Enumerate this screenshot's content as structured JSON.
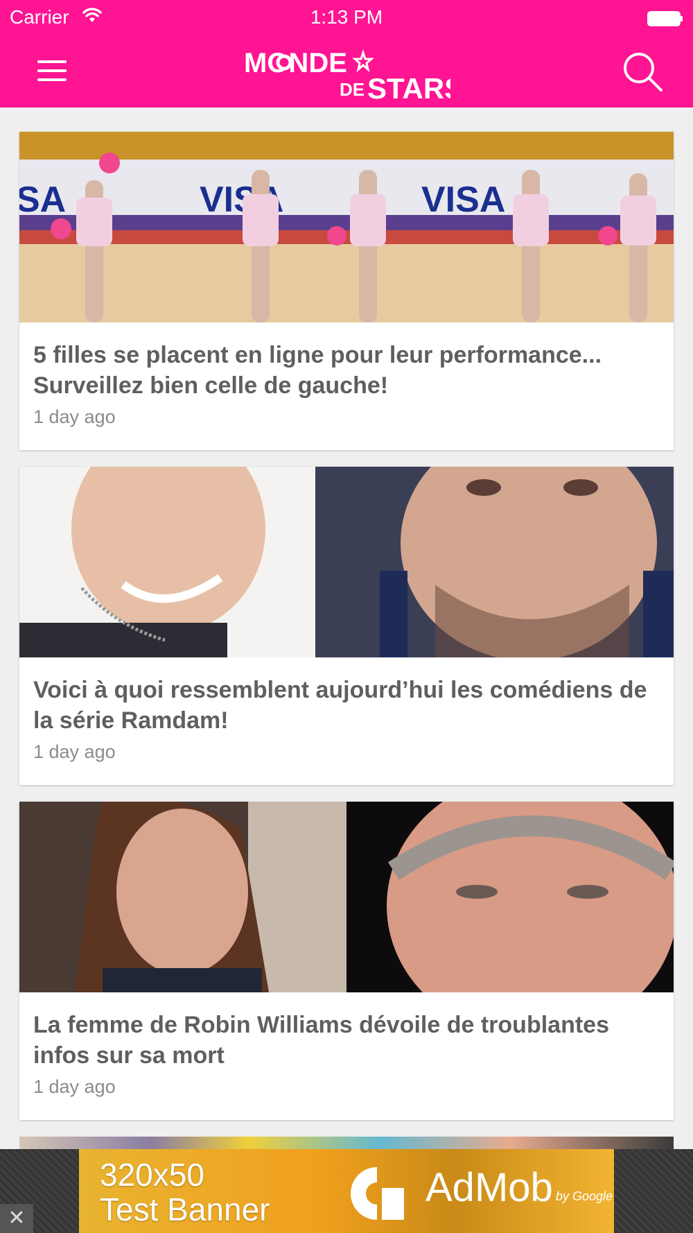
{
  "status_bar": {
    "carrier": "Carrier",
    "time": "1:13 PM"
  },
  "nav": {
    "logo_line1": "MONDE",
    "logo_line2_de": "DE",
    "logo_line2_stars": "STARS"
  },
  "articles": [
    {
      "title": "5 filles se placent en ligne pour leur performance... Surveillez bien celle de gauche!",
      "time": "1 day ago",
      "image": "gymnasts-lineup"
    },
    {
      "title": "Voici à quoi ressemblent aujourd’hui les comédiens de la série Ramdam!",
      "time": "1 day ago",
      "image": "two-actors-faces"
    },
    {
      "title": "La femme de Robin Williams dévoile de troublantes infos sur sa mort",
      "time": "1 day ago",
      "image": "woman-and-robin-williams"
    }
  ],
  "ad": {
    "line1": "320x50",
    "line2": "Test Banner",
    "brand": "AdMob",
    "by": "by Google",
    "close_glyph": "✕"
  },
  "colors": {
    "brand_pink": "#ff1493",
    "title_gray": "#5f5f5f",
    "time_gray": "#8b8b8b",
    "background": "#efefef"
  }
}
